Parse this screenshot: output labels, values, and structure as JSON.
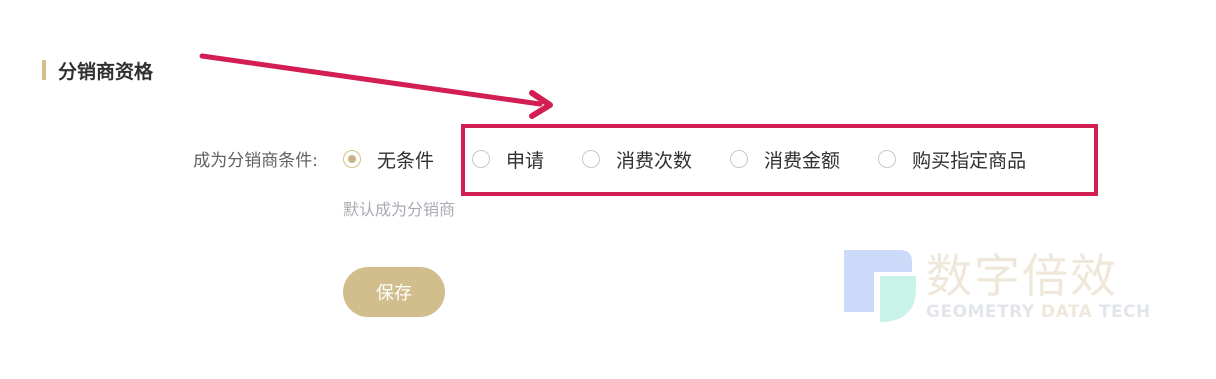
{
  "section": {
    "title": "分销商资格"
  },
  "form": {
    "condition_label": "成为分销商条件:",
    "options": [
      {
        "label": "无条件",
        "checked": true
      },
      {
        "label": "申请",
        "checked": false
      },
      {
        "label": "消费次数",
        "checked": false
      },
      {
        "label": "消费金额",
        "checked": false
      },
      {
        "label": "购买指定商品",
        "checked": false
      }
    ],
    "hint": "默认成为分销商",
    "save_label": "保存"
  },
  "annotation": {
    "color": "#d21e52"
  },
  "watermark": {
    "cn": "数字倍效",
    "en_part1": "GEOMETRY ",
    "en_part2": "DATA",
    "en_part3": " TECH"
  },
  "colors": {
    "accent": "#d4bf8c",
    "button": "#d2bd8d",
    "highlight": "#d21e52"
  }
}
